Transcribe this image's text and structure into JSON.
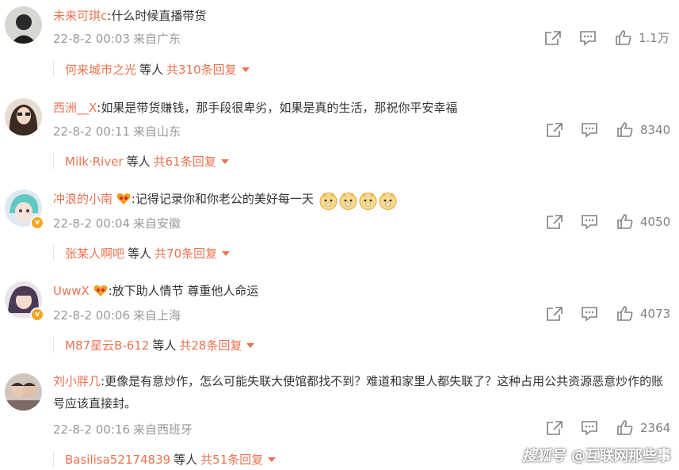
{
  "comments": [
    {
      "user": "未来可琪c",
      "text": "什么时候直播带货",
      "time": "22-8-2 00:03",
      "location": "来自广东",
      "likes": "1.1万",
      "reply_user": "何来城市之光",
      "reply_mid": "等人",
      "reply_count": "共310条回复"
    },
    {
      "user": "西洲__X",
      "text": "如果是带货赚钱，那手段很卑劣，如果是真的生活，那祝你平安幸福",
      "time": "22-8-2 00:11",
      "location": "来自山东",
      "likes": "8340",
      "reply_user": "Milk·River",
      "reply_mid": "等人",
      "reply_count": "共61条回复"
    },
    {
      "user": "冲浪的小南",
      "text": "记得记录你和你老公的美好每一天",
      "time": "22-8-2 00:04",
      "location": "来自安徽",
      "likes": "4050",
      "reply_user": "张某人啊吧",
      "reply_mid": "等人",
      "reply_count": "共70条回复"
    },
    {
      "user": "UwwX",
      "text": "放下助人情节 尊重他人命运",
      "time": "22-8-2 00:06",
      "location": "来自上海",
      "likes": "4073",
      "reply_user": "M87星云B-612",
      "reply_mid": "等人",
      "reply_count": "共28条回复"
    },
    {
      "user": "刘小胖几",
      "text": "更像是有意炒作，怎么可能失联大使馆都找不到？难道和家里人都失联了？这种占用公共资源恶意炒作的账号应该直接封。",
      "time": "22-8-2 00:16",
      "location": "来自西班牙",
      "likes": "2364",
      "reply_user": "Basilisa52174839",
      "reply_mid": "等人",
      "reply_count": "共51条回复"
    }
  ],
  "watermark": {
    "logo": "搜狐号",
    "text": "@互联网那些事"
  }
}
